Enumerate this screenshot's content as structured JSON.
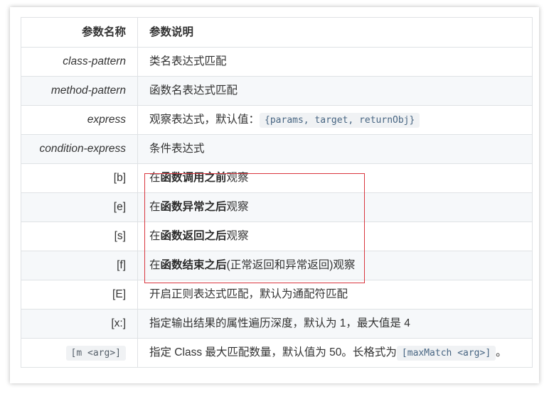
{
  "table": {
    "headers": {
      "name": "参数名称",
      "desc": "参数说明"
    },
    "rows": [
      {
        "name": "class-pattern",
        "desc": "类名表达式匹配"
      },
      {
        "name": "method-pattern",
        "desc": "函数名表达式匹配"
      },
      {
        "name": "express",
        "desc_prefix": "观察表达式，默认值：",
        "desc_code": "{params, target, returnObj}"
      },
      {
        "name": "condition-express",
        "desc": "条件表达式"
      },
      {
        "name": "[b]",
        "desc_pre": "在",
        "desc_bold": "函数调用之前",
        "desc_post": "观察"
      },
      {
        "name": "[e]",
        "desc_pre": "在",
        "desc_bold": "函数异常之后",
        "desc_post": "观察"
      },
      {
        "name": "[s]",
        "desc_pre": "在",
        "desc_bold": "函数返回之后",
        "desc_post": "观察"
      },
      {
        "name": "[f]",
        "desc_pre": "在",
        "desc_bold": "函数结束之后",
        "desc_post": "(正常返回和异常返回)观察"
      },
      {
        "name": "[E]",
        "desc": "开启正则表达式匹配，默认为通配符匹配"
      },
      {
        "name": "[x:]",
        "desc": "指定输出结果的属性遍历深度，默认为 1，最大值是 4"
      },
      {
        "name_code": "[m <arg>]",
        "desc_prefix": "指定 Class 最大匹配数量，默认值为 50。长格式为",
        "desc_code": "[maxMatch <arg>]",
        "desc_suffix": "。"
      }
    ]
  },
  "colors": {
    "highlight_border": "#d9363e",
    "alt_row_bg": "#f6f8fa",
    "border": "#dfe2e5"
  }
}
